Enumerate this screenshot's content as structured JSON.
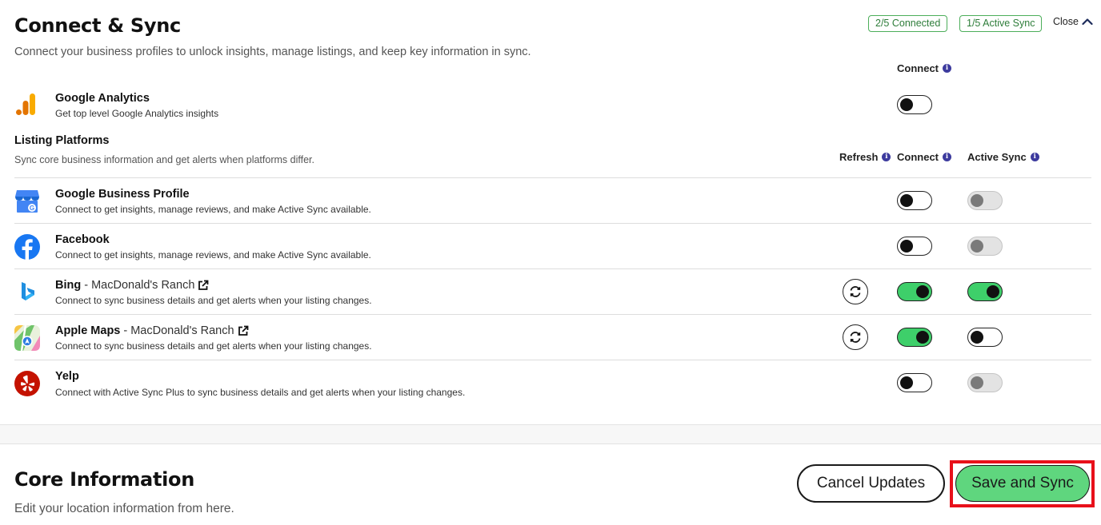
{
  "header": {
    "title": "Connect & Sync",
    "subtitle": "Connect your business profiles to unlock insights, manage listings, and keep key information in sync.",
    "badge_connected": "2/5 Connected",
    "badge_active_sync": "1/5 Active Sync",
    "close_label": "Close"
  },
  "columns": {
    "connect": "Connect",
    "refresh": "Refresh",
    "active_sync": "Active Sync"
  },
  "analytics": {
    "name": "Google Analytics",
    "description": "Get top level Google Analytics insights",
    "connected": false
  },
  "listing_section": {
    "title": "Listing Platforms",
    "description": "Sync core business information and get alerts when platforms differ."
  },
  "platforms": [
    {
      "name": "Google Business Profile",
      "location": "",
      "description": "Connect to get insights, manage reviews, and make Active Sync available.",
      "connected": false,
      "active_sync": "disabled",
      "refresh": false
    },
    {
      "name": "Facebook",
      "location": "",
      "description": "Connect to get insights, manage reviews, and make Active Sync available.",
      "connected": false,
      "active_sync": "disabled",
      "refresh": false
    },
    {
      "name": "Bing",
      "location": " - MacDonald's Ranch",
      "description": "Connect to sync business details and get alerts when your listing changes.",
      "connected": true,
      "active_sync": "on",
      "refresh": true
    },
    {
      "name": "Apple Maps",
      "location": " - MacDonald's Ranch",
      "description": "Connect to sync business details and get alerts when your listing changes.",
      "connected": true,
      "active_sync": "off",
      "refresh": true
    },
    {
      "name": "Yelp",
      "location": "",
      "description": "Connect with Active Sync Plus to sync business details and get alerts when your listing changes.",
      "connected": false,
      "active_sync": "disabled",
      "refresh": false
    }
  ],
  "core": {
    "title": "Core Information",
    "description": "Edit your location information from here."
  },
  "actions": {
    "cancel_label": "Cancel Updates",
    "save_label": "Save and Sync"
  },
  "colors": {
    "toggle_on": "#3ecf6a",
    "save_button": "#5fd67e",
    "badge_border": "#4cae5a",
    "highlight": "#e8101a"
  }
}
